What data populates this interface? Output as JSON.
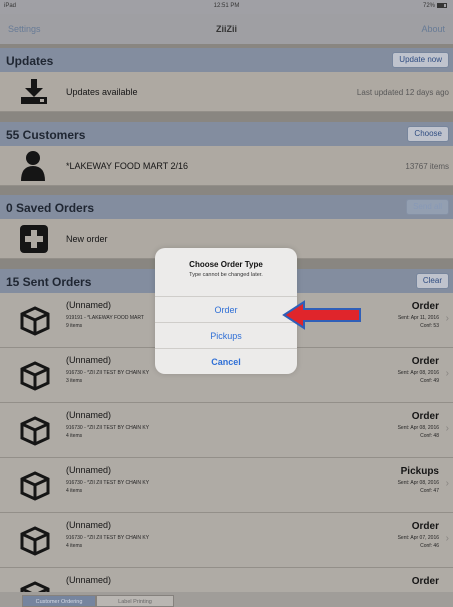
{
  "status_bar": {
    "carrier": "iPad",
    "time": "12:51 PM",
    "battery": "72%"
  },
  "nav": {
    "left": "Settings",
    "title": "ZiiZii",
    "right": "About"
  },
  "updates": {
    "header": "Updates",
    "button": "Update now",
    "row_text": "Updates available",
    "row_right": "Last updated 12 days ago",
    "icon": "download-icon"
  },
  "customers": {
    "header": "55 Customers",
    "button": "Choose",
    "row_text": "*LAKEWAY FOOD MART  2/16",
    "row_right": "13767 items",
    "icon": "person-icon"
  },
  "saved_orders": {
    "header": "0 Saved Orders",
    "button": "Send all",
    "row_text": "New order",
    "icon": "plus-icon"
  },
  "sent_orders": {
    "header": "15 Sent Orders",
    "button": "Clear",
    "rows": [
      {
        "name": "(Unnamed)",
        "desc": "919191 - *LAKEWAY FOOD MART",
        "items": "9 items",
        "type": "Order",
        "sent": "Sent: Apr 11, 2016",
        "conf": "Conf: 53"
      },
      {
        "name": "(Unnamed)",
        "desc": "916730 - *ZII ZII TEST BY CHAIN KY",
        "items": "3 items",
        "type": "Order",
        "sent": "Sent: Apr 08, 2016",
        "conf": "Conf: 49"
      },
      {
        "name": "(Unnamed)",
        "desc": "916730 - *ZII ZII TEST BY CHAIN KY",
        "items": "4 items",
        "type": "Order",
        "sent": "Sent: Apr 08, 2016",
        "conf": "Conf: 48"
      },
      {
        "name": "(Unnamed)",
        "desc": "916730 - *ZII ZII TEST BY CHAIN KY",
        "items": "4 items",
        "type": "Pickups",
        "sent": "Sent: Apr 08, 2016",
        "conf": "Conf: 47"
      },
      {
        "name": "(Unnamed)",
        "desc": "916730 - *ZII ZII TEST BY CHAIN KY",
        "items": "4 items",
        "type": "Order",
        "sent": "Sent: Apr 07, 2016",
        "conf": "Conf: 46"
      },
      {
        "name": "(Unnamed)",
        "desc": "",
        "items": "",
        "type": "Order",
        "sent": "",
        "conf": ""
      }
    ]
  },
  "dialog": {
    "title": "Choose Order Type",
    "message": "Type cannot be changed later.",
    "buttons": [
      "Order",
      "Pickups",
      "Cancel"
    ]
  },
  "tabs": [
    "Customer Ordering",
    "Label Printing"
  ],
  "colors": {
    "accent": "#2f6fd6",
    "arrow": "#e0252b",
    "header": "#8893a6"
  }
}
